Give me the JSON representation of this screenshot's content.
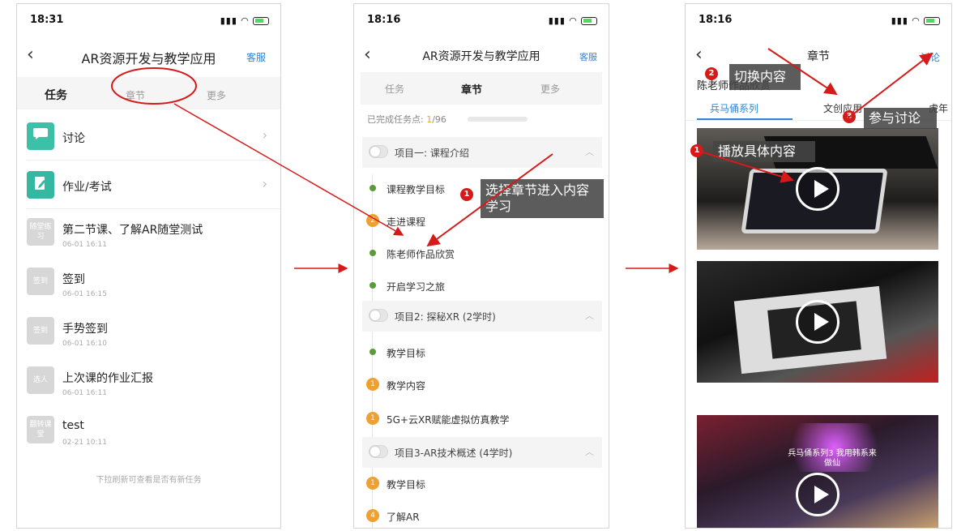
{
  "screen1": {
    "status_time": "18:31",
    "title": "AR资源开发与教学应用",
    "service": "客服",
    "tabs": [
      "任务",
      "章节",
      "更多"
    ],
    "items": [
      {
        "title": "讨论"
      },
      {
        "title": "作业/考试"
      }
    ],
    "tasks": [
      {
        "badge": "随堂练习",
        "title": "第二节课、了解AR随堂测试",
        "time": "06-01 16:11"
      },
      {
        "badge": "签到",
        "title": "签到",
        "time": "06-01 16:15"
      },
      {
        "badge": "签到",
        "title": "手势签到",
        "time": "06-01 16:10"
      },
      {
        "badge": "选人",
        "title": "上次课的作业汇报",
        "time": "06-01 16:11"
      },
      {
        "badge": "翻转课堂",
        "title": "test",
        "time": "02-21 10:11"
      }
    ],
    "footer": "下拉刷新可查看是否有新任务"
  },
  "screen2": {
    "status_time": "18:16",
    "title": "AR资源开发与教学应用",
    "service": "客服",
    "tabs": [
      "任务",
      "章节",
      "更多"
    ],
    "progress_label": "已完成任务点:",
    "progress_done": "1",
    "progress_total": "/96",
    "projects": [
      {
        "title": "项目一: 课程介绍",
        "chapters": [
          {
            "title": "课程教学目标",
            "mark": "dot"
          },
          {
            "title": "走进课程",
            "mark": "2"
          },
          {
            "title": "陈老师作品欣赏",
            "mark": "dot"
          },
          {
            "title": "开启学习之旅",
            "mark": "dot"
          }
        ]
      },
      {
        "title": "项目2: 探秘XR (2学时)",
        "chapters": [
          {
            "title": "教学目标",
            "mark": "dot"
          },
          {
            "title": "教学内容",
            "mark": "1"
          },
          {
            "title": "5G+云XR赋能虚拟仿真教学",
            "mark": "1"
          }
        ]
      },
      {
        "title": "项目3-AR技术概述 (4学时)",
        "chapters": [
          {
            "title": "教学目标",
            "mark": "1"
          },
          {
            "title": "了解AR",
            "mark": "4"
          }
        ]
      }
    ],
    "callout": {
      "num": "1",
      "text": "选择章节进入内容学习"
    }
  },
  "screen3": {
    "status_time": "18:16",
    "title": "章节",
    "discuss": "讨论",
    "subtitle": "陈老师作品欣赏",
    "tabs": [
      "兵马俑系列",
      "文创应用",
      "虎年"
    ],
    "callouts": [
      {
        "num": "2",
        "text": "切换内容"
      },
      {
        "num": "3",
        "text": "参与讨论"
      },
      {
        "num": "1",
        "text": "播放具体内容"
      }
    ],
    "video3_text": "兵马俑系列3 我用韩系来做仙"
  },
  "colors": {
    "accent_blue": "#2f84d6",
    "arrow_red": "#d61a1a",
    "chat_icon_teal": "#3cc0a7",
    "edit_icon_teal": "#35b8a2",
    "progress_orange": "#f0a030",
    "done_green": "#5a9b3a"
  }
}
